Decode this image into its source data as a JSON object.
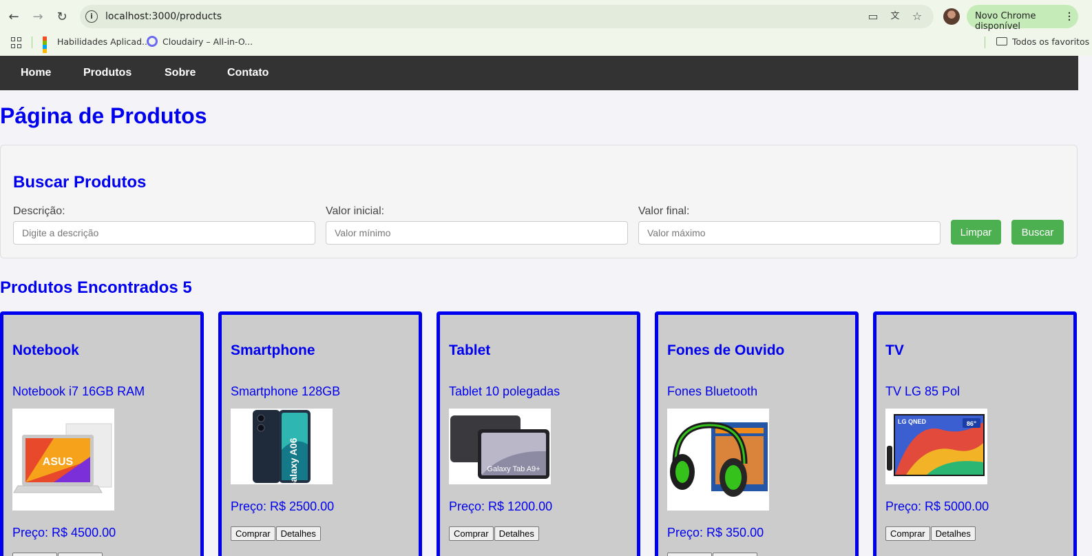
{
  "browser": {
    "url": "localhost:3000/products",
    "update_label": "Novo Chrome disponível",
    "bookmarks": [
      {
        "label": "Habilidades Aplicad..."
      },
      {
        "label": "Cloudairy – All-in-O..."
      }
    ],
    "all_bookmarks_label": "Todos os favoritos",
    "icons": [
      "back-icon",
      "forward-icon",
      "reload-icon",
      "site-info-icon",
      "install-app-icon",
      "translate-icon",
      "star-icon",
      "apps-icon",
      "folder-icon"
    ]
  },
  "nav": {
    "items": [
      {
        "label": "Home"
      },
      {
        "label": "Produtos"
      },
      {
        "label": "Sobre"
      },
      {
        "label": "Contato"
      }
    ]
  },
  "page": {
    "title": "Página de Produtos"
  },
  "search": {
    "title": "Buscar Produtos",
    "description_label": "Descrição:",
    "description_placeholder": "Digite a descrição",
    "min_label": "Valor inicial:",
    "min_placeholder": "Valor mínimo",
    "max_label": "Valor final:",
    "max_placeholder": "Valor máximo",
    "clear_label": "Limpar",
    "search_label": "Buscar"
  },
  "results": {
    "title": "Produtos Encontrados 5",
    "buy_label": "Comprar",
    "details_label": "Detalhes",
    "products": [
      {
        "name": "Notebook",
        "description": "Notebook i7 16GB RAM",
        "price": "Preço: R$ 4500.00"
      },
      {
        "name": "Smartphone",
        "description": "Smartphone 128GB",
        "price": "Preço: R$ 2500.00"
      },
      {
        "name": "Tablet",
        "description": "Tablet 10 polegadas",
        "price": "Preço: R$ 1200.00"
      },
      {
        "name": "Fones de Ouvido",
        "description": "Fones Bluetooth",
        "price": "Preço: R$ 350.00"
      },
      {
        "name": "TV",
        "description": "TV LG 85 Pol",
        "price": "Preço: R$ 5000.00"
      }
    ]
  },
  "image_text": {
    "laptop_brand": "ASUS",
    "phone_model": "Galaxy A06",
    "tablet_model": "Galaxy Tab A9+",
    "tv_brand": "LG QNED",
    "tv_size": "86\""
  },
  "colors": {
    "accent_blue": "#0000ee",
    "nav_bg": "#333333",
    "button_green": "#4caf50",
    "card_bg": "#cccccc"
  }
}
